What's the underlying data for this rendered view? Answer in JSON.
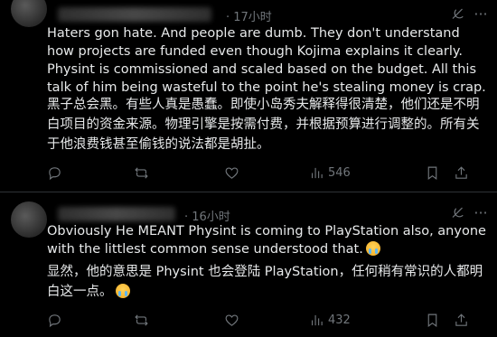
{
  "posts": [
    {
      "time": "· 17小时",
      "text_en": "Haters gon hate. And people are dumb. They don't understand how projects are funded even though Kojima explains it clearly. Physint is commissioned and scaled based on the budget. All this talk of him being wasteful to the point he's stealing money is crap.",
      "text_zh": "黑子总会黑。有些人真是愚蠢。即使小岛秀夫解释得很清楚，他们还是不明白项目的资金来源。物理引擎是按需付费，并根据预算进行调整的。所有关于他浪费钱甚至偷钱的说法都是胡扯。",
      "views": "546"
    },
    {
      "time": "· 16小时",
      "text_en": "Obviously He MEANT Physint is coming to PlayStation also, anyone with the littlest common sense understood that.",
      "text_zh": "显然，他的意思是 Physint 也会登陆 PlayStation，任何稍有常识的人都明白这一点。",
      "views": "432"
    }
  ],
  "icons": {
    "grok": "grok-icon",
    "more": "more-icon",
    "reply": "reply-icon",
    "retweet": "retweet-icon",
    "like": "like-icon",
    "views": "views-icon",
    "bookmark": "bookmark-icon",
    "share": "share-icon",
    "emoji": "loudly-crying-face-emoji"
  },
  "colors": {
    "background": "#000000",
    "text": "#e7e9ea",
    "muted": "#71767b",
    "divider": "#2f3336"
  }
}
